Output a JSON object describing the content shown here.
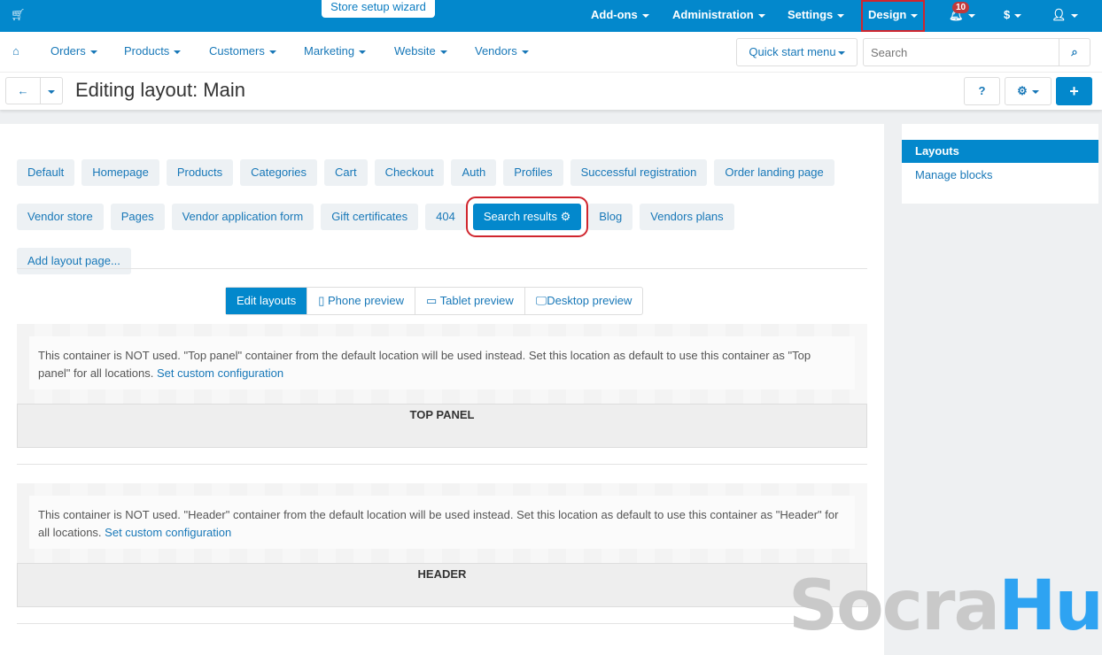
{
  "topbar": {
    "wizard": "Store setup wizard",
    "items": [
      "Add-ons",
      "Administration",
      "Settings",
      "Design"
    ],
    "notifications": "10",
    "currency": "$"
  },
  "nav": {
    "items": [
      "Orders",
      "Products",
      "Customers",
      "Marketing",
      "Website",
      "Vendors"
    ],
    "quick_start": "Quick start menu",
    "search_placeholder": "Search"
  },
  "toolbar": {
    "title": "Editing layout: Main"
  },
  "sidebar": {
    "active": "Layouts",
    "link": "Manage blocks"
  },
  "tabs": [
    "Default",
    "Homepage",
    "Products",
    "Categories",
    "Cart",
    "Checkout",
    "Auth",
    "Profiles",
    "Successful registration",
    "Order landing page",
    "Vendor store",
    "Pages",
    "Vendor application form",
    "Gift certificates",
    "404",
    "Search results",
    "Blog",
    "Vendors plans",
    "Add layout page..."
  ],
  "preview": [
    "Edit layouts",
    "Phone preview",
    "Tablet preview",
    "Desktop preview"
  ],
  "containers": [
    {
      "note": "This container is NOT used. \"Top panel\" container from the default location will be used instead. Set this location as default to use this container as \"Top panel\" for all locations.",
      "link": "Set custom configuration",
      "title": "TOP PANEL"
    },
    {
      "note": "This container is NOT used. \"Header\" container from the default location will be used instead. Set this location as default to use this container as \"Header\" for all locations.",
      "link": "Set custom configuration",
      "title": "HEADER"
    }
  ],
  "watermark": {
    "part1": "Socra",
    "part2": "Hub"
  }
}
